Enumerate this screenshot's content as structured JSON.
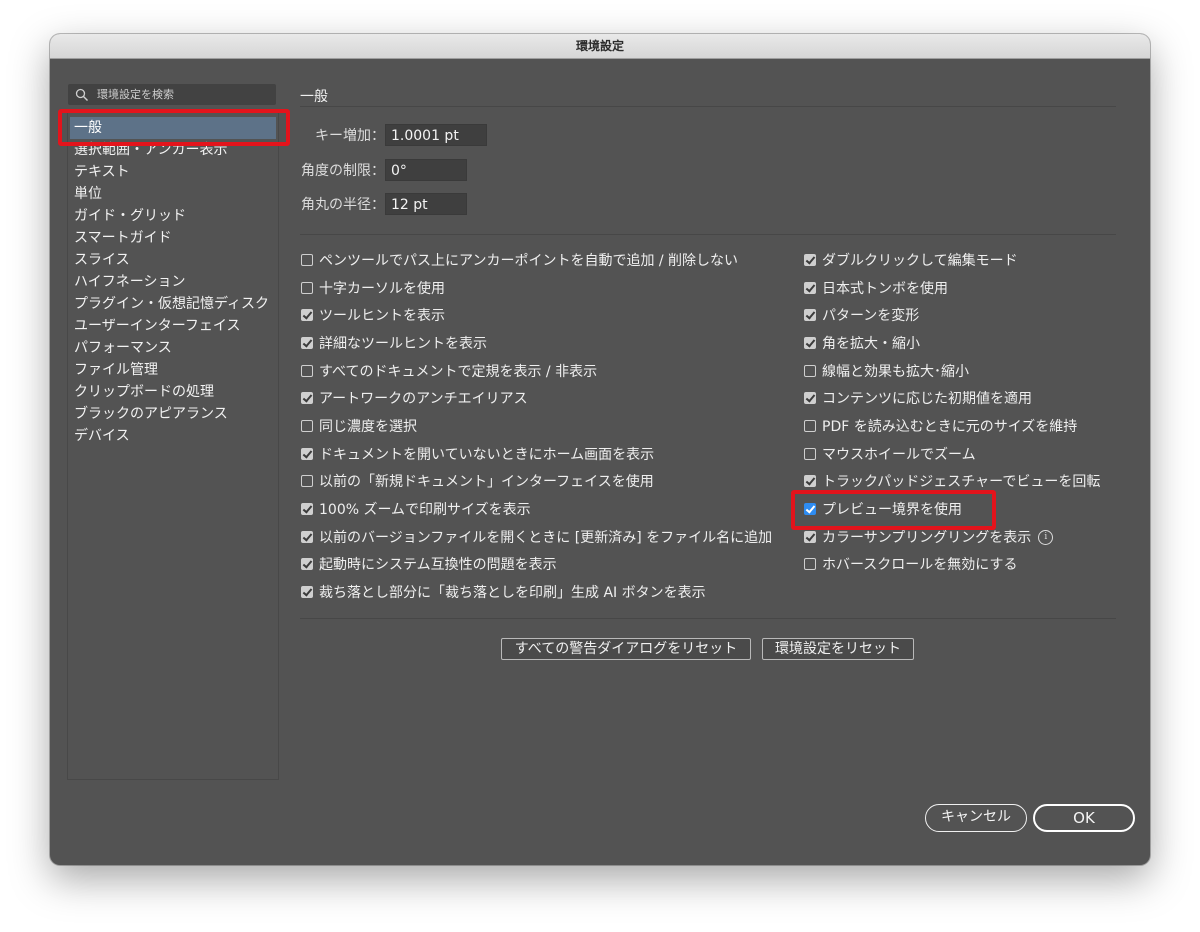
{
  "window": {
    "title": "環境設定"
  },
  "sidebar": {
    "search_placeholder": "環境設定を検索",
    "items": [
      {
        "label": "一般",
        "selected": true
      },
      {
        "label": "選択範囲・アンカー表示"
      },
      {
        "label": "テキスト"
      },
      {
        "label": "単位"
      },
      {
        "label": "ガイド・グリッド"
      },
      {
        "label": "スマートガイド"
      },
      {
        "label": "スライス"
      },
      {
        "label": "ハイフネーション"
      },
      {
        "label": "プラグイン・仮想記憶ディスク"
      },
      {
        "label": "ユーザーインターフェイス"
      },
      {
        "label": "パフォーマンス"
      },
      {
        "label": "ファイル管理"
      },
      {
        "label": "クリップボードの処理"
      },
      {
        "label": "ブラックのアピアランス"
      },
      {
        "label": "デバイス"
      }
    ]
  },
  "main": {
    "title": "一般",
    "fields": [
      {
        "label": "キー増加：",
        "value": "1.0001 pt"
      },
      {
        "label": "角度の制限：",
        "value": "0°"
      },
      {
        "label": "角丸の半径：",
        "value": "12 pt"
      }
    ],
    "left_checks": [
      {
        "label": "ペンツールでパス上にアンカーポイントを自動で追加 / 削除しない",
        "checked": false
      },
      {
        "label": "十字カーソルを使用",
        "checked": false
      },
      {
        "label": "ツールヒントを表示",
        "checked": true
      },
      {
        "label": "詳細なツールヒントを表示",
        "checked": true
      },
      {
        "label": "すべてのドキュメントで定規を表示 / 非表示",
        "checked": false
      },
      {
        "label": "アートワークのアンチエイリアス",
        "checked": true
      },
      {
        "label": "同じ濃度を選択",
        "checked": false
      },
      {
        "label": "ドキュメントを開いていないときにホーム画面を表示",
        "checked": true
      },
      {
        "label": "以前の「新規ドキュメント」インターフェイスを使用",
        "checked": false
      },
      {
        "label": "100% ズームで印刷サイズを表示",
        "checked": true
      },
      {
        "label": "以前のバージョンファイルを開くときに [更新済み] をファイル名に追加",
        "checked": true
      },
      {
        "label": "起動時にシステム互換性の問題を表示",
        "checked": true
      },
      {
        "label": "裁ち落とし部分に「裁ち落としを印刷」生成 AI ボタンを表示",
        "checked": true
      }
    ],
    "right_checks": [
      {
        "label": "ダブルクリックして編集モード",
        "checked": true
      },
      {
        "label": "日本式トンボを使用",
        "checked": true
      },
      {
        "label": "パターンを変形",
        "checked": true
      },
      {
        "label": "角を拡大・縮小",
        "checked": true
      },
      {
        "label": "線幅と効果も拡大･縮小",
        "checked": false
      },
      {
        "label": "コンテンツに応じた初期値を適用",
        "checked": true
      },
      {
        "label": "PDF を読み込むときに元のサイズを維持",
        "checked": false
      },
      {
        "label": "マウスホイールでズーム",
        "checked": false
      },
      {
        "label": "トラックパッドジェスチャーでビューを回転",
        "checked": true
      },
      {
        "label": "プレビュー境界を使用",
        "checked": true,
        "focused": true
      },
      {
        "label": "カラーサンプリングリングを表示",
        "checked": true,
        "info": true
      },
      {
        "label": "ホバースクロールを無効にする",
        "checked": false
      }
    ],
    "reset_warnings_label": "すべての警告ダイアログをリセット",
    "reset_prefs_label": "環境設定をリセット"
  },
  "footer": {
    "cancel_label": "キャンセル",
    "ok_label": "OK"
  },
  "colors": {
    "panel_bg": "#535353",
    "selection": "#5d7288",
    "highlight": "#e3141c",
    "accent_check": "#2e8cf2"
  }
}
